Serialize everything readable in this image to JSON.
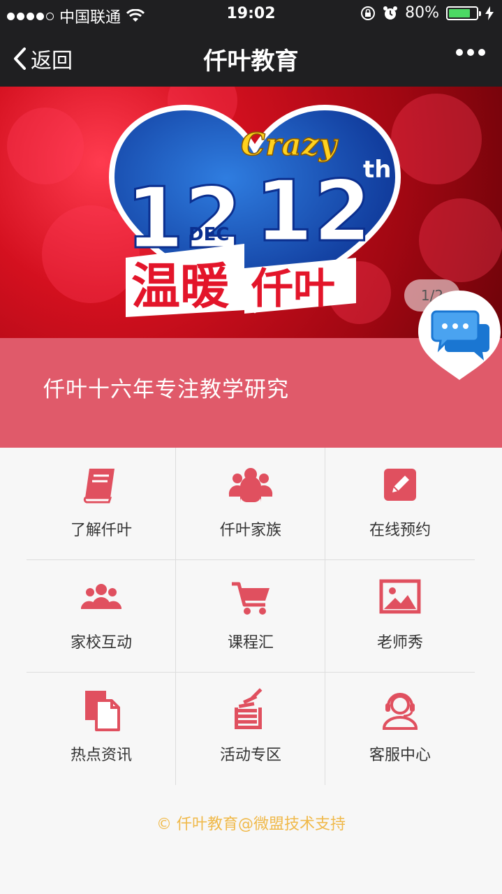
{
  "status_bar": {
    "carrier": "中国联通",
    "time": "19:02",
    "battery_percent": "80%",
    "battery_level": 0.8,
    "icons": [
      "signal-dots",
      "wifi-icon",
      "rotation-lock-icon",
      "alarm-icon",
      "battery-icon",
      "charging-bolt-icon"
    ]
  },
  "nav": {
    "back_label": "返回",
    "title": "仟叶教育"
  },
  "banner": {
    "crazy": "Crazy",
    "big_left": "12",
    "big_right": "12",
    "suffix": "th",
    "month": "DEC",
    "line1": "温暖",
    "line2": "仟叶",
    "pager": "1/2"
  },
  "caption": {
    "text": "仟叶十六年专注教学研究"
  },
  "grid": {
    "items": [
      {
        "label": "了解仟叶",
        "icon": "book-icon"
      },
      {
        "label": "仟叶家族",
        "icon": "group-icon"
      },
      {
        "label": "在线预约",
        "icon": "edit-icon"
      },
      {
        "label": "家校互动",
        "icon": "users-icon"
      },
      {
        "label": "课程汇",
        "icon": "cart-icon"
      },
      {
        "label": "老师秀",
        "icon": "picture-icon"
      },
      {
        "label": "热点资讯",
        "icon": "documents-icon"
      },
      {
        "label": "活动专区",
        "icon": "stack-icon"
      },
      {
        "label": "客服中心",
        "icon": "headset-icon"
      }
    ]
  },
  "footer": {
    "text": "© 仟叶教育@微盟技术支持"
  },
  "colors": {
    "accent": "#e05a6a",
    "icon": "#e0505f",
    "topbar": "#1f1f21",
    "footer_text": "#f0b94a"
  }
}
